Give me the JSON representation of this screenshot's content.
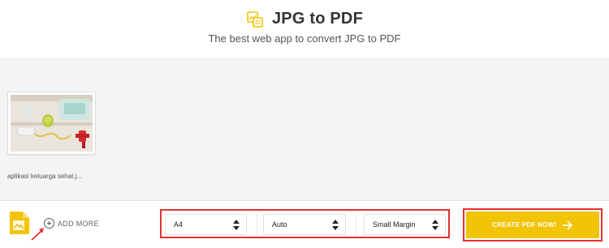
{
  "header": {
    "title": "JPG to PDF",
    "subtitle": "The best web app to convert JPG to PDF"
  },
  "files": [
    {
      "name": "aplikasi keluarga sehat.j..."
    }
  ],
  "toolbar": {
    "add_more_label": "ADD MORE",
    "page_size": "A4",
    "orientation": "Auto",
    "margin": "Small Margin",
    "create_label": "CREATE PDF NOW!"
  },
  "colors": {
    "accent": "#f2c407",
    "highlight": "#e53030"
  },
  "icons": {
    "logo": "image-to-pdf-icon",
    "file_type": "image-file-icon",
    "add": "plus-circle-icon",
    "select_caret": "sort-arrows-icon",
    "proceed": "arrow-right-icon"
  }
}
